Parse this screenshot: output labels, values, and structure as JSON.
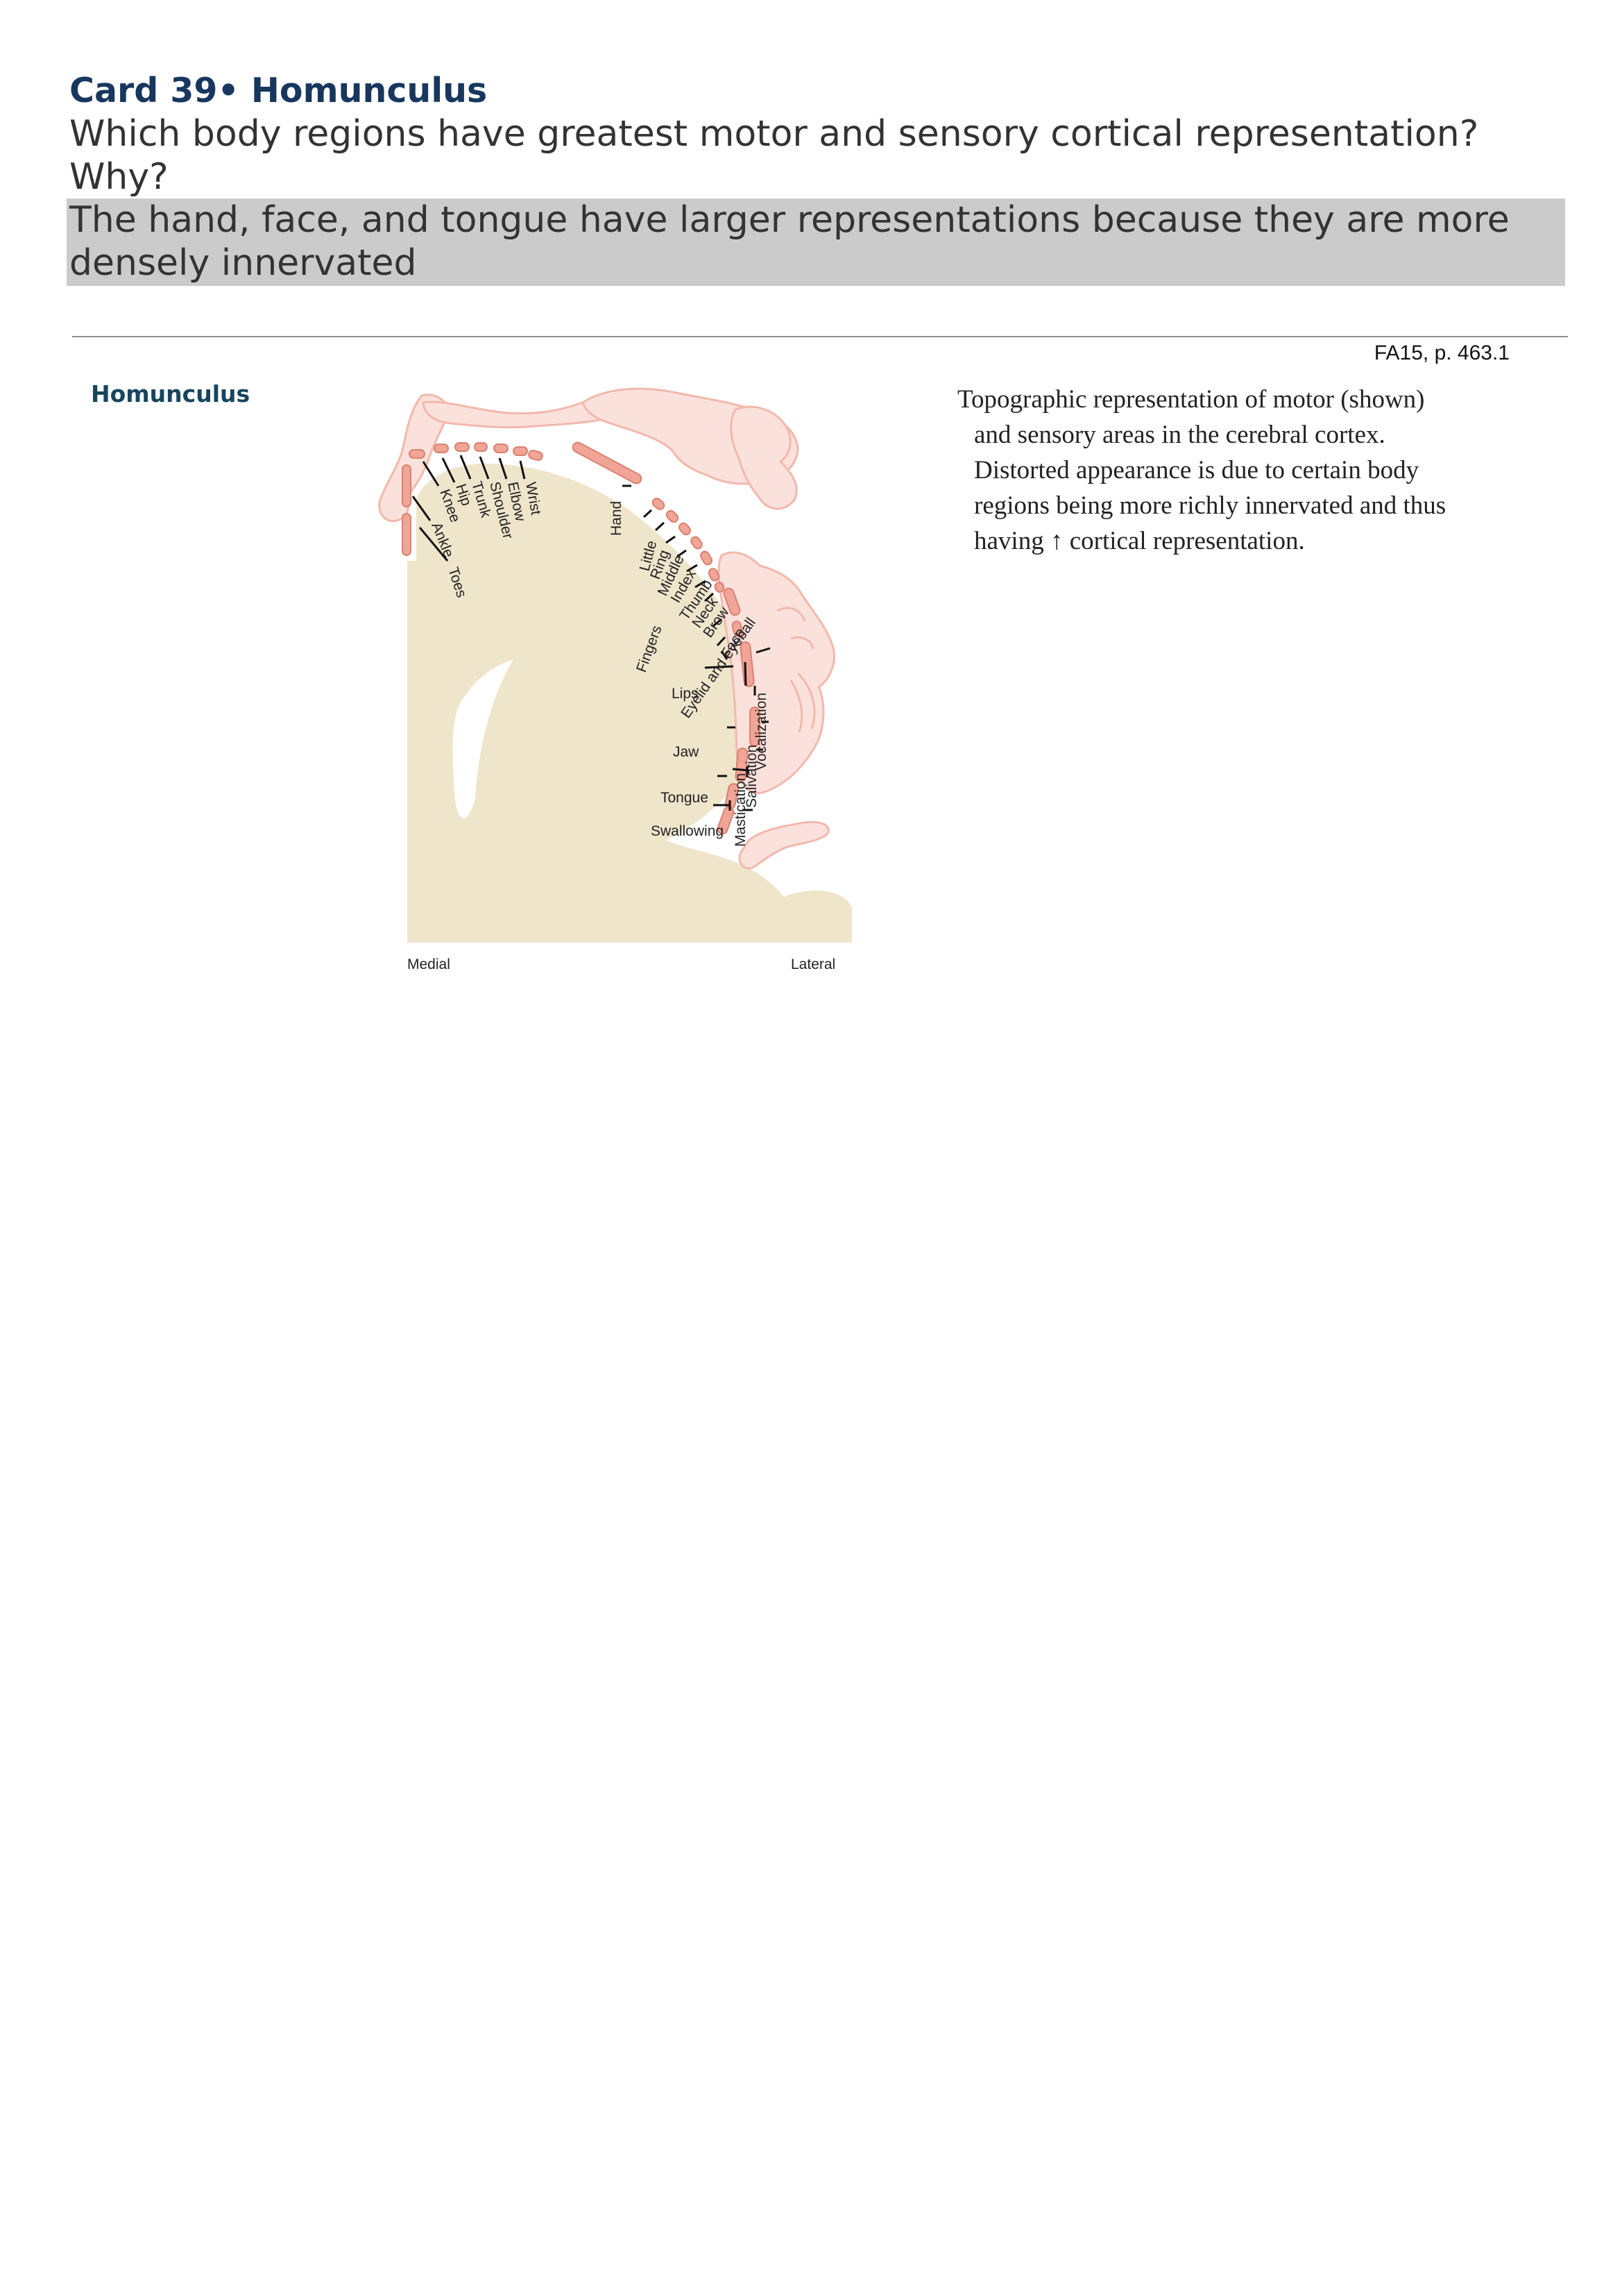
{
  "card": {
    "title": "Card 39• Homunculus",
    "question": "Which body regions have greatest motor and sensory cortical representation? Why?",
    "answer": "The hand, face, and tongue have larger representations because they are more densely innervated"
  },
  "source": "FA15, p. 463.1",
  "section": {
    "heading": "Homunculus",
    "description": {
      "line1": "Topographic representation of motor (shown)",
      "line2": "and sensory areas in the cerebral cortex.",
      "line3": "Distorted appearance is due to certain body",
      "line4": "regions being more richly innervated and thus",
      "line5_prefix": "having ",
      "line5_arrow": "↑",
      "line5_suffix": " cortical representation."
    }
  },
  "figure": {
    "labels": {
      "toes": "Toes",
      "ankle": "Ankle",
      "knee": "Knee",
      "hip": "Hip",
      "trunk": "Trunk",
      "shoulder": "Shoulder",
      "elbow": "Elbow",
      "wrist": "Wrist",
      "hand": "Hand",
      "little": "Little",
      "ring": "Ring",
      "middle": "Middle",
      "index": "Index",
      "thumb": "Thumb",
      "neck": "Neck",
      "brow": "Brow",
      "eyelid": "Eyelid and eyeball",
      "face": "Face",
      "fingers": "Fingers",
      "lips": "Lips",
      "vocalization": "Vocalization",
      "jaw": "Jaw",
      "salivation": "Salivation",
      "tongue": "Tongue",
      "mastication": "Mastication",
      "swallowing": "Swallowing"
    },
    "axis": {
      "medial": "Medial",
      "lateral": "Lateral"
    },
    "colors": {
      "cortex": "#efe5cb",
      "homunculus": "#fbe1dc",
      "homunculus_outline": "#f2b8ac",
      "segment": "#f0a596"
    }
  }
}
